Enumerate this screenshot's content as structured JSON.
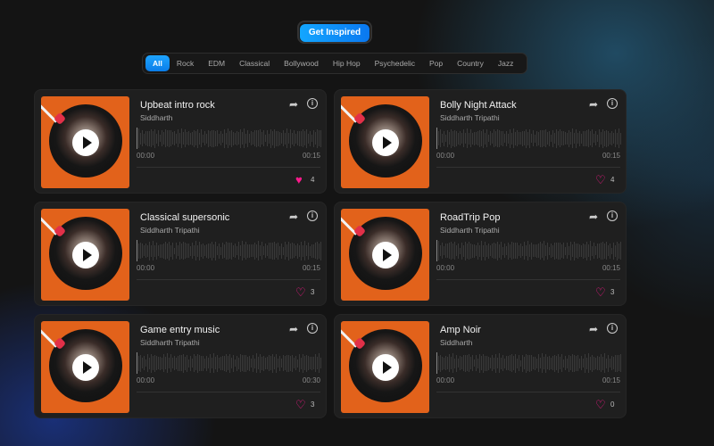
{
  "header": {
    "cta_label": "Get Inspired"
  },
  "filters": [
    "All",
    "Rock",
    "EDM",
    "Classical",
    "Bollywood",
    "Hip Hop",
    "Psychedelic",
    "Pop",
    "Country",
    "Jazz"
  ],
  "active_filter": "All",
  "colors": {
    "accent": "#0a8cf5",
    "heart": "#ff1a8c",
    "art_bg": "#e2621b"
  },
  "tracks": [
    {
      "title": "Upbeat intro rock",
      "artist": "Siddharth",
      "start": "00:00",
      "end": "00:15",
      "likes": "4",
      "liked": true
    },
    {
      "title": "Bolly Night Attack",
      "artist": "Siddharth Tripathi",
      "start": "00:00",
      "end": "00:15",
      "likes": "4",
      "liked": false
    },
    {
      "title": "Classical supersonic",
      "artist": "Siddharth Tripathi",
      "start": "00:00",
      "end": "00:15",
      "likes": "3",
      "liked": false
    },
    {
      "title": "RoadTrip Pop",
      "artist": "Siddharth Tripathi",
      "start": "00:00",
      "end": "00:15",
      "likes": "3",
      "liked": false
    },
    {
      "title": "Game entry music",
      "artist": "Siddharth Tripathi",
      "start": "00:00",
      "end": "00:30",
      "likes": "3",
      "liked": false
    },
    {
      "title": "Amp Noir",
      "artist": "Siddharth",
      "start": "00:00",
      "end": "00:15",
      "likes": "0",
      "liked": false
    }
  ]
}
